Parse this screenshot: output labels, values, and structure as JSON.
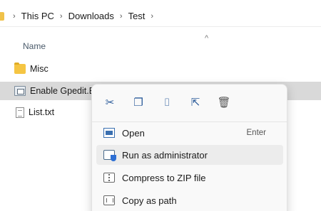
{
  "breadcrumb": {
    "items": [
      "This PC",
      "Downloads",
      "Test"
    ],
    "separator": "›"
  },
  "column_header": {
    "name": "Name",
    "sort_caret": "^"
  },
  "files": [
    {
      "name": "Misc",
      "type": "folder"
    },
    {
      "name": "Enable Gpedit.BA",
      "type": "bat",
      "selected": true
    },
    {
      "name": "List.txt",
      "type": "txt"
    }
  ],
  "context_menu": {
    "toolbar": [
      {
        "action": "cut",
        "icon": "scissors-icon",
        "glyph": "✂"
      },
      {
        "action": "copy",
        "icon": "copy-icon",
        "glyph": "❐"
      },
      {
        "action": "rename",
        "icon": "rename-icon",
        "glyph": "⌷"
      },
      {
        "action": "share",
        "icon": "share-icon",
        "glyph": "⇱"
      },
      {
        "action": "delete",
        "icon": "trash-icon",
        "glyph": "🗑"
      }
    ],
    "items": [
      {
        "label": "Open",
        "shortcut": "Enter",
        "icon": "open-icon"
      },
      {
        "label": "Run as administrator",
        "shortcut": "",
        "icon": "shield-icon",
        "hovered": true
      },
      {
        "label": "Compress to ZIP file",
        "shortcut": "",
        "icon": "zip-icon"
      },
      {
        "label": "Copy as path",
        "shortcut": "",
        "icon": "path-icon"
      }
    ]
  },
  "colors": {
    "selected_row": "#d9d9d9",
    "hover_item": "#ececec",
    "accent": "#2b5b9a",
    "folder": "#f5c543"
  }
}
